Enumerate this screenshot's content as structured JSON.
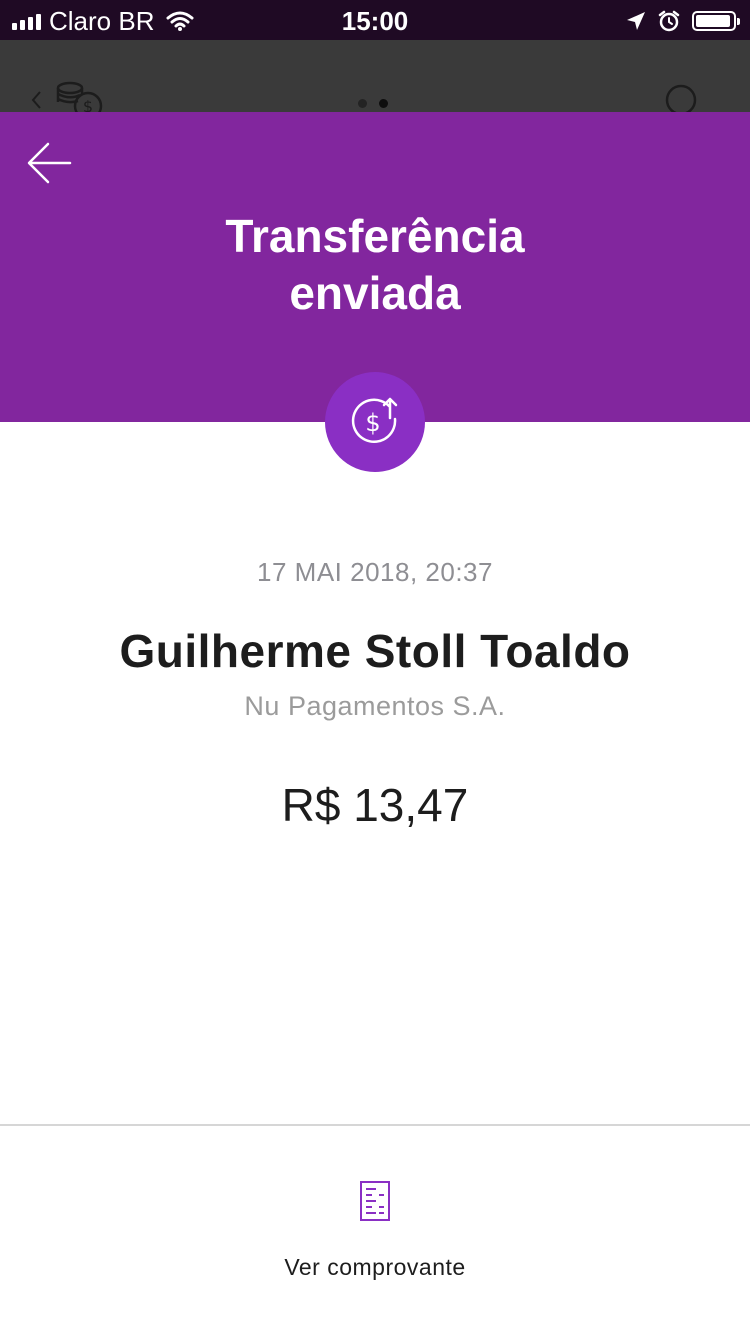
{
  "status_bar": {
    "carrier": "Claro BR",
    "time": "15:00"
  },
  "background_screen": {
    "page_dots": 2,
    "active_dot": 1
  },
  "header": {
    "title_line1": "Transferência",
    "title_line2": "enviada",
    "background_color": "#82269e",
    "badge_color": "#8a2fc4",
    "badge_icon": "money-transfer-icon"
  },
  "transfer": {
    "date": "17 MAI 2018, 20:37",
    "recipient_name": "Guilherme Stoll Toaldo",
    "institution": "Nu Pagamentos S.A.",
    "amount": "R$ 13,47"
  },
  "footer": {
    "receipt_label": "Ver comprovante",
    "receipt_icon": "receipt-icon",
    "accent_color": "#8a2fc4"
  }
}
